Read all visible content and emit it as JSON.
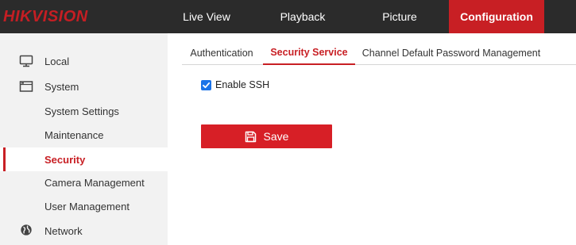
{
  "brand": {
    "logo_text": "HIKVISION"
  },
  "nav": {
    "items": [
      {
        "label": "Live View"
      },
      {
        "label": "Playback"
      },
      {
        "label": "Picture"
      },
      {
        "label": "Configuration",
        "active": true
      }
    ]
  },
  "sidebar": {
    "items": [
      {
        "label": "Local",
        "icon": "monitor-icon"
      },
      {
        "label": "System",
        "icon": "system-icon"
      },
      {
        "label": "System Settings"
      },
      {
        "label": "Maintenance"
      },
      {
        "label": "Security",
        "selected": true
      },
      {
        "label": "Camera Management"
      },
      {
        "label": "User Management"
      },
      {
        "label": "Network",
        "icon": "globe-icon"
      }
    ]
  },
  "tabs": [
    {
      "label": "Authentication"
    },
    {
      "label": "Security Service",
      "active": true
    },
    {
      "label": "Channel Default Password Management"
    }
  ],
  "security_service": {
    "enable_ssh_label": "Enable SSH",
    "enable_ssh_checked": true,
    "save_label": "Save"
  },
  "colors": {
    "accent": "#c81f24",
    "topbar": "#2b2b2b",
    "sidebar": "#f2f2f2",
    "checkbox": "#1a73e8"
  }
}
